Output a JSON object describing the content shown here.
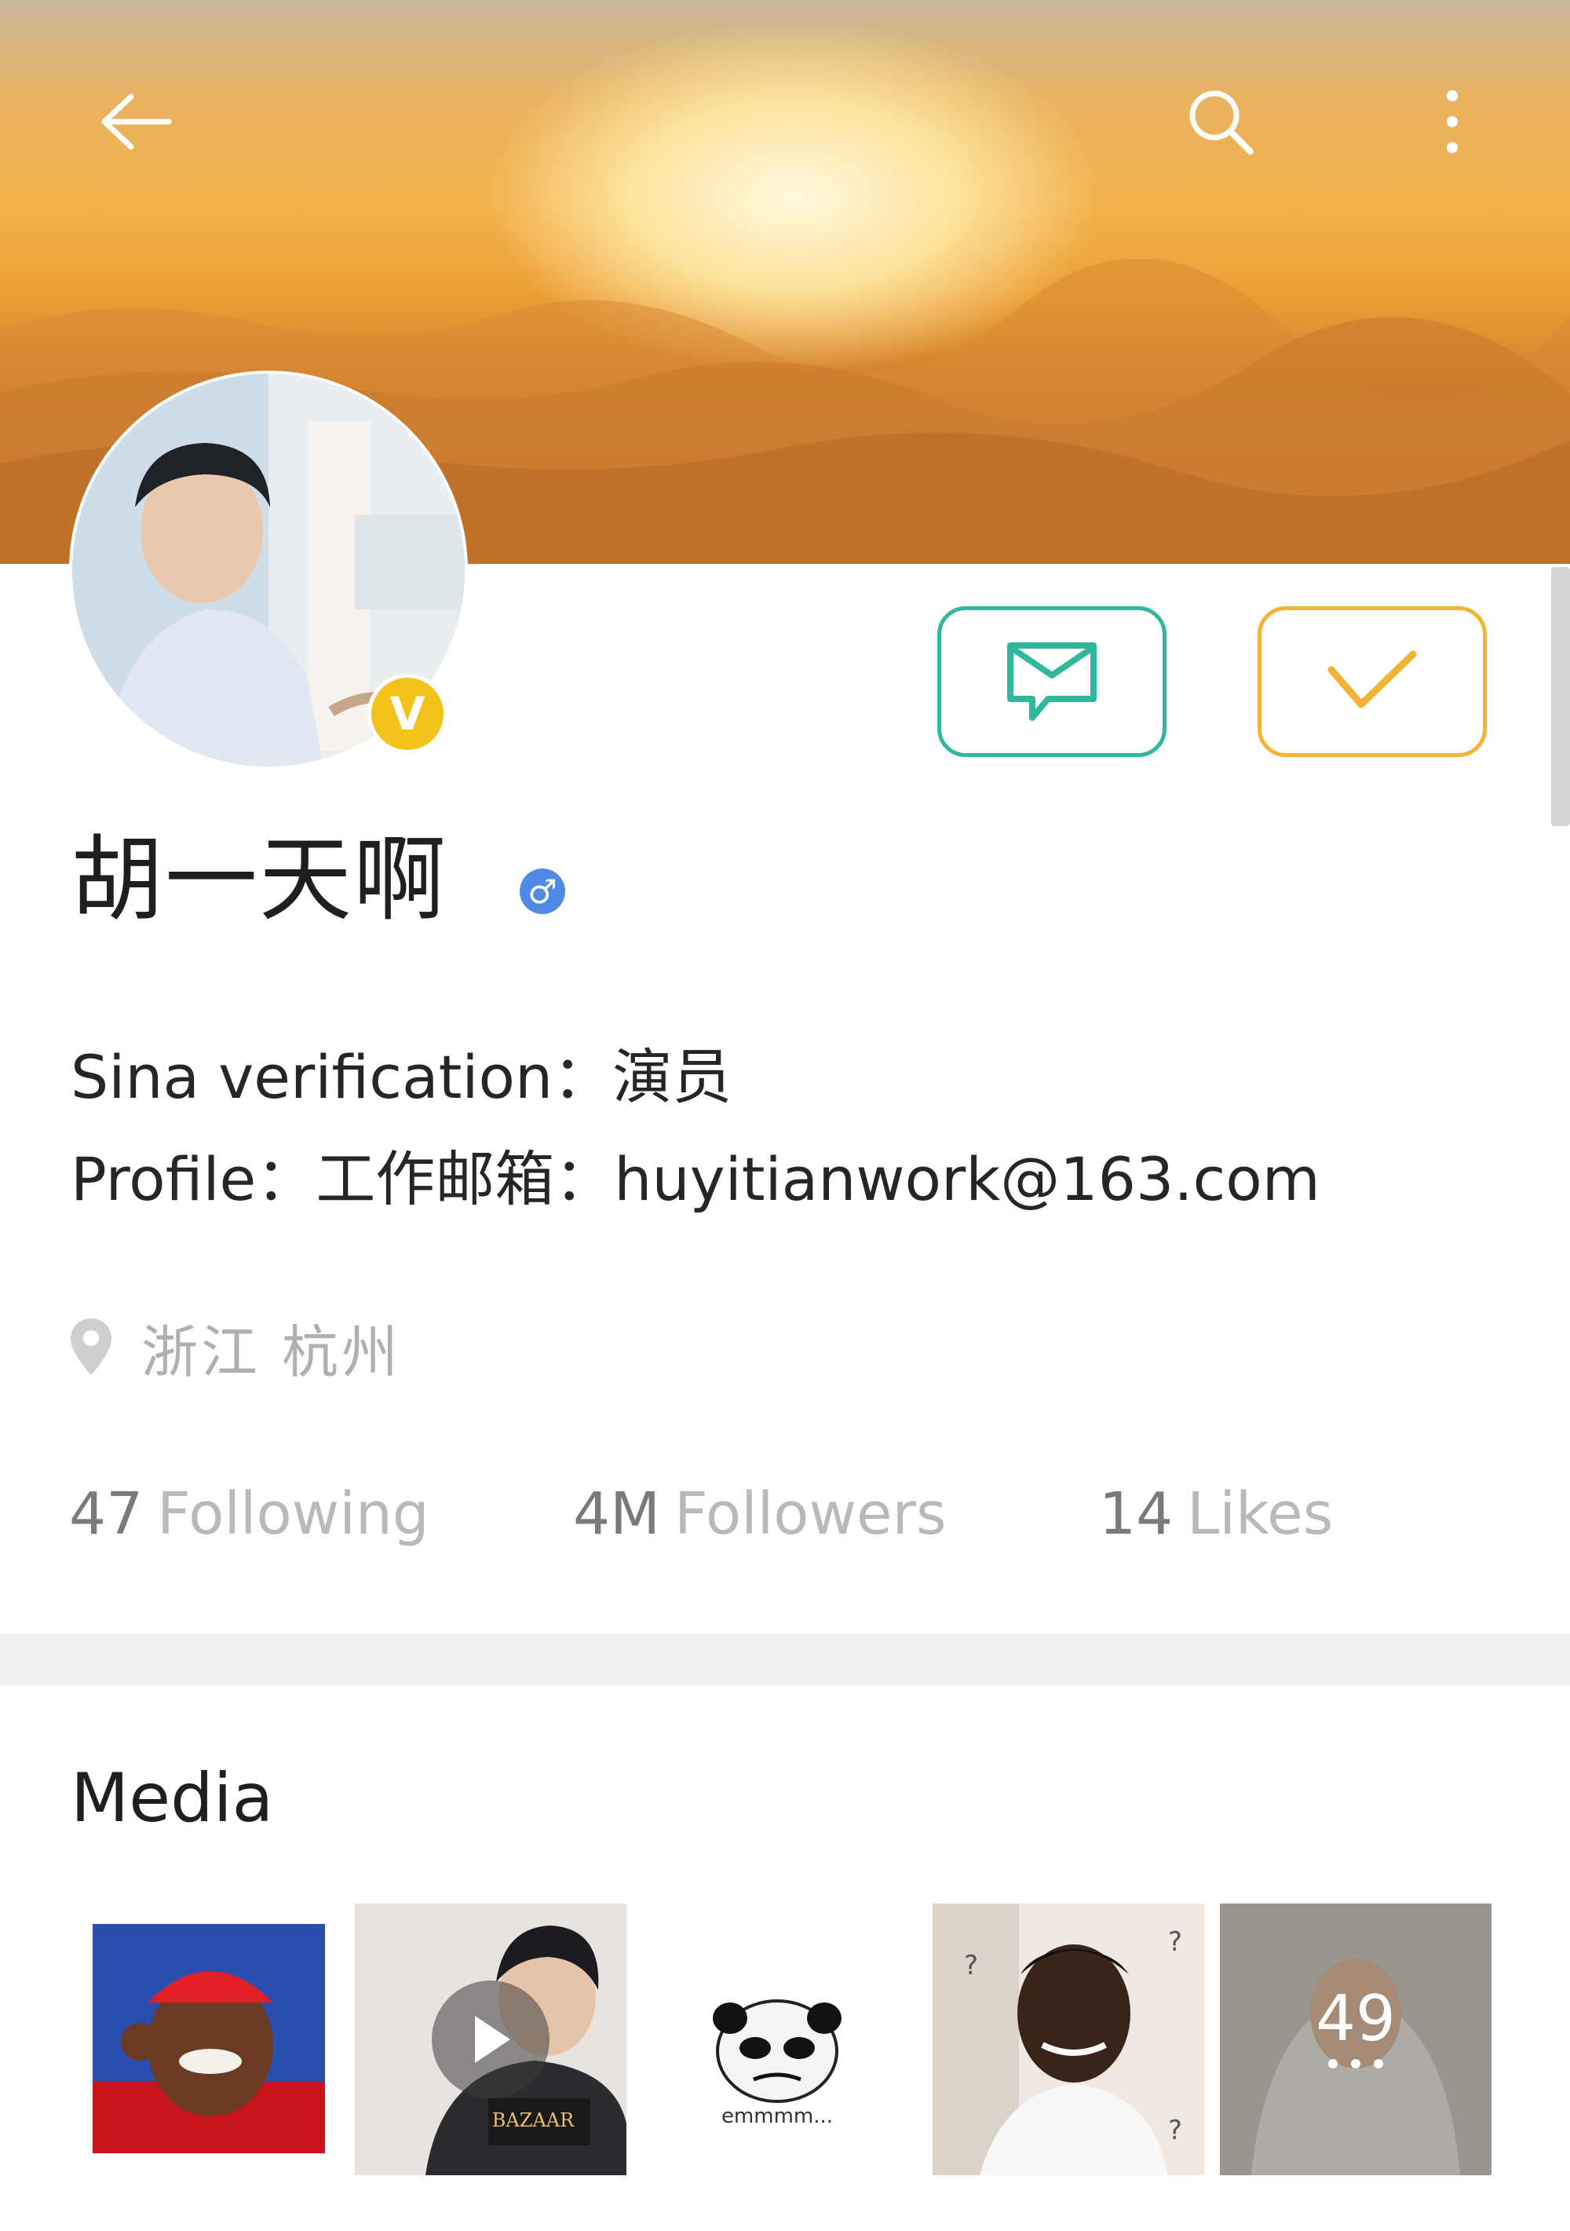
{
  "app_bar": {
    "back_icon": "arrow-left-icon",
    "search_icon": "search-icon",
    "more_icon": "more-vertical-icon"
  },
  "profile": {
    "name": "胡一天啊",
    "verified": true,
    "verified_badge_letter": "V",
    "gender": "male",
    "gender_symbol": "♂",
    "verification_label": "Sina verification",
    "verification_value": "演员",
    "profile_label": "Profile",
    "profile_value": "工作邮箱：huyitianwork@163.com",
    "separator": "：",
    "location": "浙江 杭州"
  },
  "actions": {
    "message_icon": "message-icon",
    "following_icon": "checkmark-icon"
  },
  "stats": [
    {
      "value": "47",
      "label": "Following"
    },
    {
      "value": "4M",
      "label": "Followers"
    },
    {
      "value": "14",
      "label": "Likes"
    }
  ],
  "media": {
    "title": "Media",
    "items": [
      {
        "kind": "image"
      },
      {
        "kind": "video",
        "caption": "BAZAAR"
      },
      {
        "kind": "sticker",
        "caption": "emmmm..."
      },
      {
        "kind": "image"
      },
      {
        "kind": "more",
        "count": "49"
      }
    ]
  },
  "colors": {
    "accent_green": "#2fb89d",
    "accent_orange": "#f3b335",
    "verified_gold": "#f4c21a",
    "gender_blue": "#4f8ae6"
  }
}
